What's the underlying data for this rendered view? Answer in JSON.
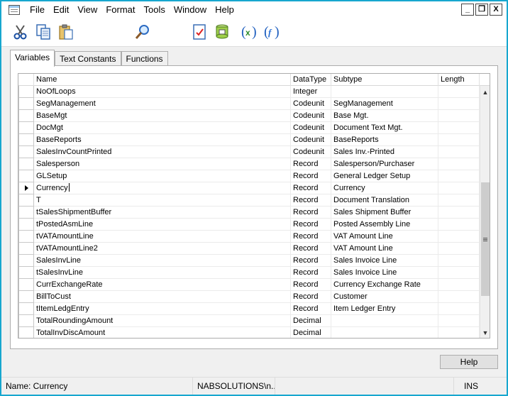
{
  "menu": [
    "File",
    "Edit",
    "View",
    "Format",
    "Tools",
    "Window",
    "Help"
  ],
  "window_controls": {
    "minimize": "_",
    "restore": "❐",
    "close": "X"
  },
  "toolbar": {
    "icons": [
      "cut-icon",
      "copy-icon",
      "paste-icon",
      "find-icon",
      "properties-icon",
      "database-icon",
      "symbol-menu-icon",
      "help-on-symbol-icon"
    ]
  },
  "tabs": [
    {
      "label": "Variables",
      "active": true
    },
    {
      "label": "Text Constants",
      "active": false
    },
    {
      "label": "Functions",
      "active": false
    }
  ],
  "grid": {
    "columns": [
      "Name",
      "DataType",
      "Subtype",
      "Length"
    ],
    "rows": [
      {
        "name": "NoOfLoops",
        "type": "Integer",
        "sub": "",
        "len": ""
      },
      {
        "name": "SegManagement",
        "type": "Codeunit",
        "sub": "SegManagement",
        "len": ""
      },
      {
        "name": "BaseMgt",
        "type": "Codeunit",
        "sub": "Base Mgt.",
        "len": ""
      },
      {
        "name": "DocMgt",
        "type": "Codeunit",
        "sub": "Document Text Mgt.",
        "len": ""
      },
      {
        "name": "BaseReports",
        "type": "Codeunit",
        "sub": "BaseReports",
        "len": ""
      },
      {
        "name": "SalesInvCountPrinted",
        "type": "Codeunit",
        "sub": "Sales Inv.-Printed",
        "len": ""
      },
      {
        "name": "Salesperson",
        "type": "Record",
        "sub": "Salesperson/Purchaser",
        "len": ""
      },
      {
        "name": "GLSetup",
        "type": "Record",
        "sub": "General Ledger Setup",
        "len": ""
      },
      {
        "name": "Currency",
        "type": "Record",
        "sub": "Currency",
        "len": ""
      },
      {
        "name": "T",
        "type": "Record",
        "sub": "Document Translation",
        "len": ""
      },
      {
        "name": "tSalesShipmentBuffer",
        "type": "Record",
        "sub": "Sales Shipment Buffer",
        "len": ""
      },
      {
        "name": "tPostedAsmLine",
        "type": "Record",
        "sub": "Posted Assembly Line",
        "len": ""
      },
      {
        "name": "tVATAmountLine",
        "type": "Record",
        "sub": "VAT Amount Line",
        "len": ""
      },
      {
        "name": "tVATAmountLine2",
        "type": "Record",
        "sub": "VAT Amount Line",
        "len": ""
      },
      {
        "name": "SalesInvLine",
        "type": "Record",
        "sub": "Sales Invoice Line",
        "len": ""
      },
      {
        "name": "tSalesInvLine",
        "type": "Record",
        "sub": "Sales Invoice Line",
        "len": ""
      },
      {
        "name": "CurrExchangeRate",
        "type": "Record",
        "sub": "Currency Exchange Rate",
        "len": ""
      },
      {
        "name": "BillToCust",
        "type": "Record",
        "sub": "Customer",
        "len": ""
      },
      {
        "name": "tItemLedgEntry",
        "type": "Record",
        "sub": "Item Ledger Entry",
        "len": ""
      },
      {
        "name": "TotalRoundingAmount",
        "type": "Decimal",
        "sub": "",
        "len": ""
      },
      {
        "name": "TotalInvDiscAmount",
        "type": "Decimal",
        "sub": "",
        "len": ""
      }
    ],
    "current_row_index": 8
  },
  "help_button": "Help",
  "statusbar": {
    "name": "Name: Currency",
    "user": "NABSOLUTIONS\\n...",
    "mode": "INS"
  }
}
